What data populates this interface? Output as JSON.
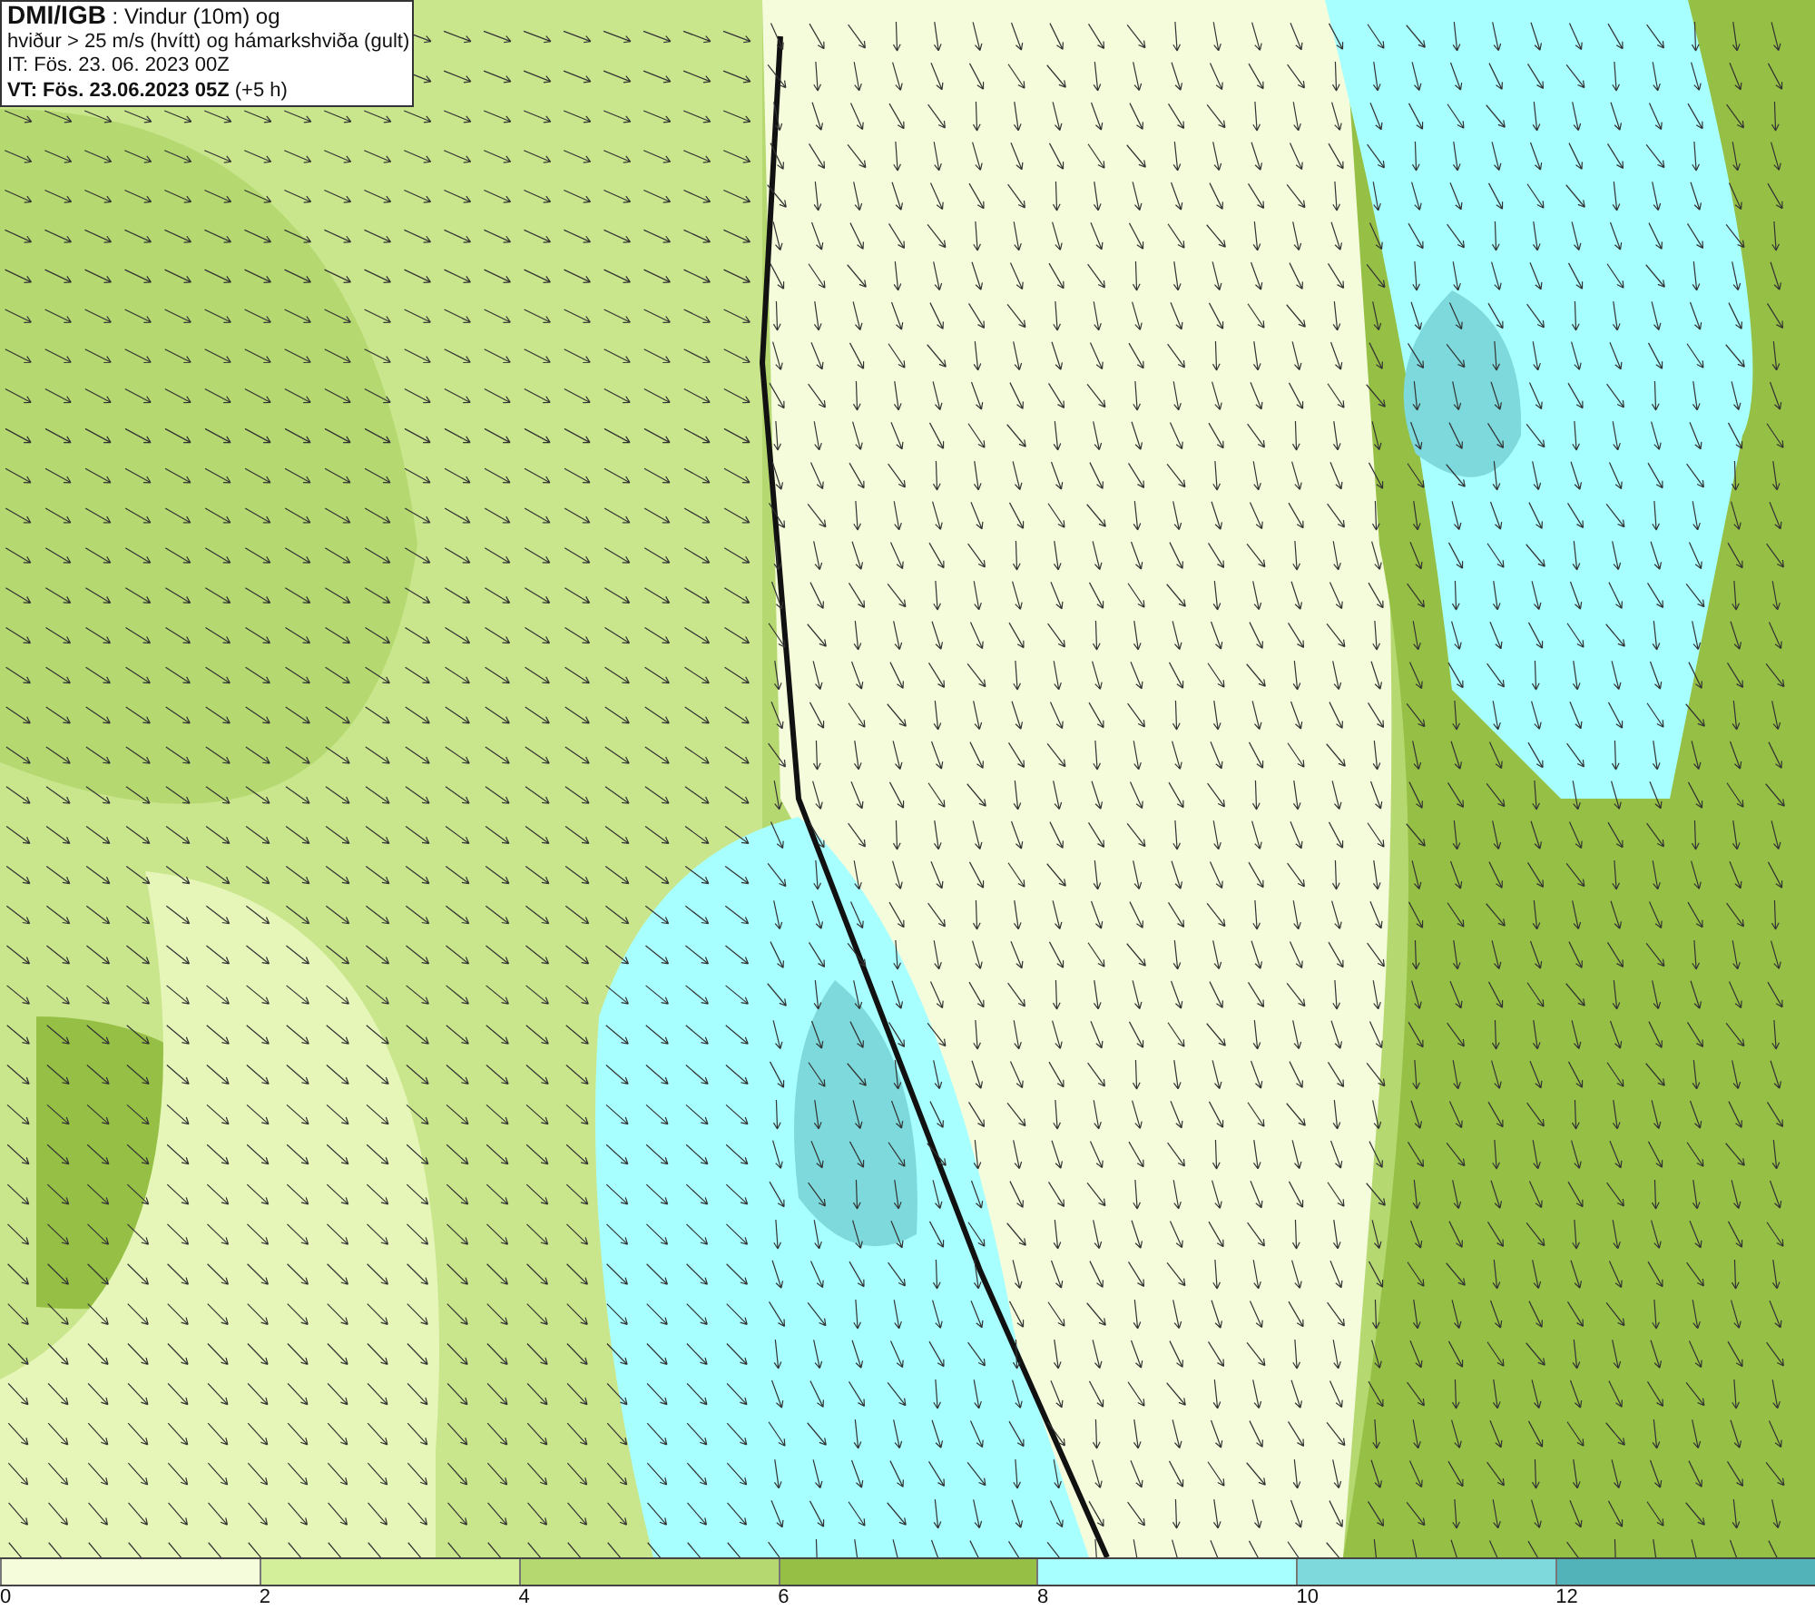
{
  "info_box": {
    "lines": [
      "**DMI/IGB** : Vindur (10m) og",
      "hviður > 25 m/s (hvítt) og hámarkshviða (gult)",
      "IT: Fös. 23. 06. 2023 00Z",
      "**VT: Fös. 23.06.2023 05Z** (+5 h)"
    ]
  },
  "legend": {
    "segments": [
      {
        "color": "#f5fcdc"
      },
      {
        "color": "#d4ef9a"
      },
      {
        "color": "#b5d970"
      },
      {
        "color": "#96c045"
      },
      {
        "color": "#a8ffff"
      },
      {
        "color": "#7dd9dc"
      },
      {
        "color": "#52b3b8"
      }
    ],
    "ticks": [
      "0",
      "2",
      "4",
      "6",
      "8",
      "10",
      "12"
    ]
  }
}
